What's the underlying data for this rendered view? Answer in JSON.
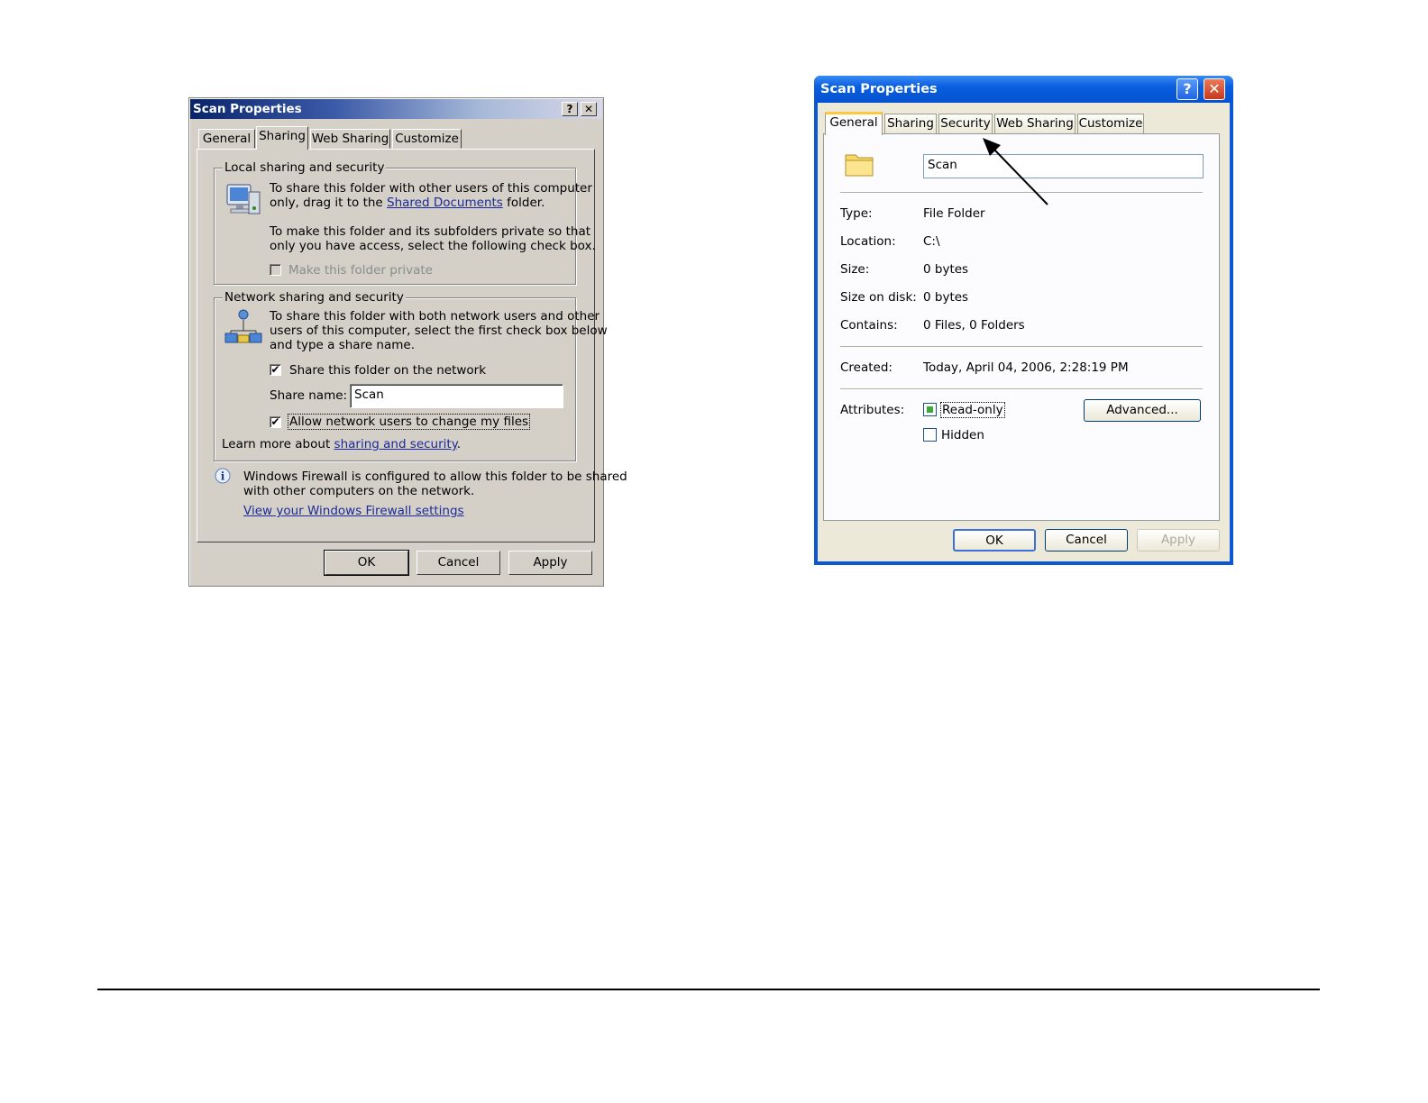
{
  "left_dialog": {
    "title": "Scan Properties",
    "help_glyph": "?",
    "close_glyph": "✕",
    "tabs": [
      "General",
      "Sharing",
      "Web Sharing",
      "Customize"
    ],
    "selected_tab": "Sharing",
    "local_group": {
      "legend": "Local sharing and security",
      "text1_line1": "To share this folder with other users of this computer",
      "text1_pre": "only, drag it to the ",
      "text1_link": "Shared Documents",
      "text1_post": " folder.",
      "text2_line1": "To make this folder and its subfolders private so that",
      "text2_line2": "only you have access, select the following check box.",
      "private_checkbox_label": "Make this folder private",
      "private_checked": false
    },
    "network_group": {
      "legend": "Network sharing and security",
      "text_line1": "To share this folder with both network users and other",
      "text_line2": "users of this computer, select the first check box below",
      "text_line3": "and type a share name.",
      "share_checkbox_label": "Share this folder on the network",
      "share_checked": true,
      "share_name_label": "Share name:",
      "share_name_value": "Scan",
      "allow_change_label": "Allow network users to change my files",
      "allow_change_checked": true,
      "learn_more_pre": "Learn more about ",
      "learn_more_link": "sharing and security",
      "learn_more_post": "."
    },
    "firewall": {
      "line1": "Windows Firewall is configured to allow this folder to be shared",
      "line2": "with other computers on the network.",
      "link": "View your Windows Firewall settings"
    },
    "buttons": {
      "ok": "OK",
      "cancel": "Cancel",
      "apply": "Apply"
    },
    "check_glyph": "✔"
  },
  "right_dialog": {
    "title": "Scan Properties",
    "help_glyph": "?",
    "close_glyph": "✕",
    "tabs": [
      "General",
      "Sharing",
      "Security",
      "Web Sharing",
      "Customize"
    ],
    "selected_tab": "General",
    "folder_name": "Scan",
    "properties": [
      {
        "label": "Type:",
        "value": "File Folder"
      },
      {
        "label": "Location:",
        "value": "C:\\"
      },
      {
        "label": "Size:",
        "value": "0 bytes"
      },
      {
        "label": "Size on disk:",
        "value": "0 bytes"
      },
      {
        "label": "Contains:",
        "value": "0 Files, 0 Folders"
      }
    ],
    "created_label": "Created:",
    "created_value": "Today, April 04, 2006, 2:28:19 PM",
    "attributes_label": "Attributes:",
    "readonly_label": "Read-only",
    "readonly_state": "indeterminate",
    "hidden_label": "Hidden",
    "hidden_checked": false,
    "advanced_button": "Advanced...",
    "buttons": {
      "ok": "OK",
      "cancel": "Cancel",
      "apply": "Apply"
    }
  },
  "colors": {
    "xp_title_blue": "#0a5ee0",
    "classic_title_dark": "#0a246a",
    "link_blue": "#1b2a9b",
    "xp_tab_highlight": "#ffc83c"
  }
}
